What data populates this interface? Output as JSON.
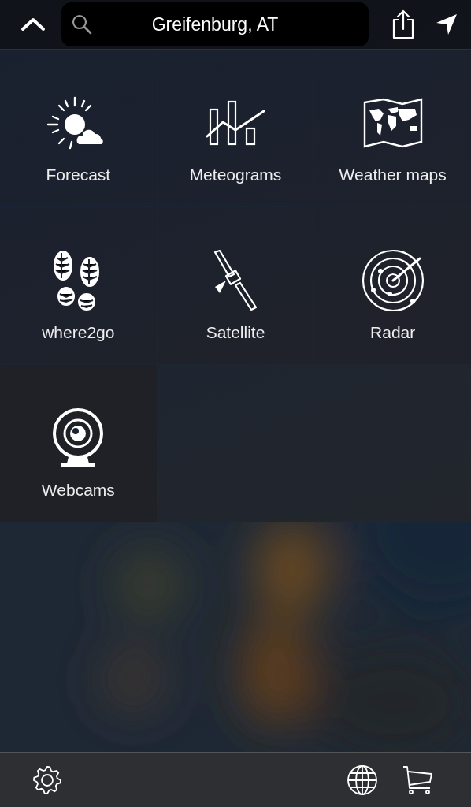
{
  "top_bar": {
    "search": {
      "value": "Greifenburg, AT"
    }
  },
  "tiles": [
    {
      "label": "Forecast"
    },
    {
      "label": "Meteograms"
    },
    {
      "label": "Weather maps"
    },
    {
      "label": "where2go"
    },
    {
      "label": "Satellite"
    },
    {
      "label": "Radar"
    },
    {
      "label": "Webcams"
    }
  ]
}
